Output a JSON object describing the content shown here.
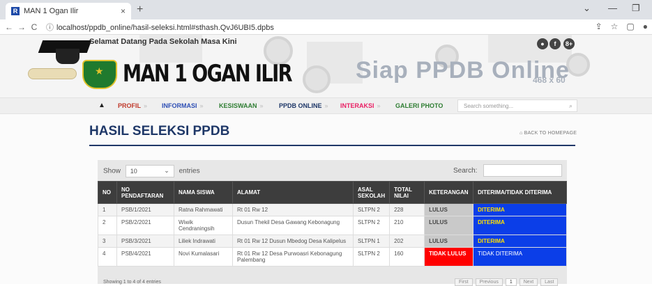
{
  "browser": {
    "tab_title": "MAN 1 Ogan Ilir",
    "tab_close": "×",
    "new_tab": "+",
    "url_info": "ⓘ",
    "url": "localhost/ppdb_online/hasil-seleksi.html#sthash.QvJ6UBI5.dpbs",
    "nav_back": "←",
    "nav_forward": "→",
    "nav_reload": "C",
    "share_icon": "⇪",
    "star_icon": "☆",
    "window_min": "—",
    "window_max": "❐",
    "window_chevron": "⌄"
  },
  "header": {
    "welcome": "Selamat Datang Pada Sekolah Masa Kini",
    "school_name": "MAN 1 OGAN ILIR",
    "banner_title": "Siap PPDB Online",
    "banner_size": "468 x 60",
    "social": [
      "●",
      "f",
      "8+"
    ]
  },
  "nav": {
    "home": "▲",
    "items": [
      {
        "label": "PROFIL",
        "color": "#c0392b"
      },
      {
        "label": "INFORMASI",
        "color": "#2e4fb5"
      },
      {
        "label": "KESISWAAN",
        "color": "#2e7d32"
      },
      {
        "label": "PPDB ONLINE",
        "color": "#1f3868"
      },
      {
        "label": "INTERAKSI",
        "color": "#e91e63"
      },
      {
        "label": "GALERI PHOTO",
        "color": "#2e7d32"
      }
    ],
    "arrow": "»",
    "search_placeholder": "Search something...",
    "search_icon": "⌕"
  },
  "page": {
    "title": "HASIL SELEKSI PPDB",
    "back_link": "⌂ BACK TO HOMEPAGE"
  },
  "datatable": {
    "show_label": "Show",
    "show_value": "10",
    "entries_label": "entries",
    "search_label": "Search:",
    "columns": [
      "NO",
      "NO PENDAFTARAN",
      "NAMA SISWA",
      "ALAMAT",
      "ASAL SEKOLAH",
      "TOTAL NILAI",
      "KETERANGAN",
      "DITERIMA/TIDAK DITERIMA"
    ],
    "rows": [
      {
        "no": "1",
        "reg": "PSB/1/2021",
        "name": "Ratna Rahmawati",
        "address": "Rt 01 Rw 12",
        "school": "SLTPN 2",
        "score": "228",
        "status": "LULUS",
        "accepted": "DITERIMA"
      },
      {
        "no": "2",
        "reg": "PSB/2/2021",
        "name": "Wiwik Cendraningsih",
        "address": "Dusun Thekil Desa Gawang Kebonagung",
        "school": "SLTPN 2",
        "score": "210",
        "status": "LULUS",
        "accepted": "DITERIMA"
      },
      {
        "no": "3",
        "reg": "PSB/3/2021",
        "name": "Liliek Indrawati",
        "address": "Rt 01 Rw 12 Dusun Mbedog Desa Kalipelus",
        "school": "SLTPN 1",
        "score": "202",
        "status": "LULUS",
        "accepted": "DITERIMA"
      },
      {
        "no": "4",
        "reg": "PSB/4/2021",
        "name": "Novi Kumalasari",
        "address": "Rt 01 Rw 12 Desa Purwoasri Kebonagung Palembang",
        "school": "SLTPN 2",
        "score": "160",
        "status": "TIDAK LULUS",
        "accepted": "TIDAK DITERIMA"
      }
    ],
    "info": "Showing 1 to 4 of 4 entries",
    "pager": [
      "First",
      "Previous",
      "1",
      "Next",
      "Last"
    ]
  },
  "colors": {
    "accent_navy": "#1f3868",
    "accepted_bg": "#0b3ee8",
    "fail_bg": "#ff0000"
  }
}
